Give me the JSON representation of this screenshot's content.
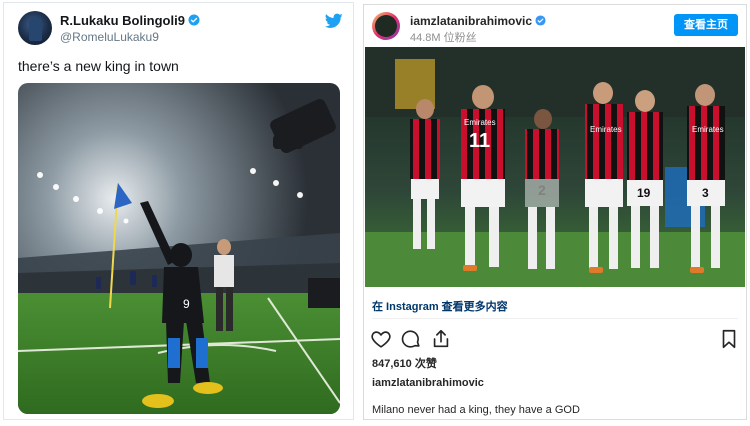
{
  "twitter": {
    "display_name": "R.Lukaku Bolingoli9",
    "handle": "@RomeluLukaku9",
    "tweet_text": "there’s a new king in town",
    "icons": {
      "verified": "verified-badge-icon",
      "logo": "twitter-bird-icon"
    },
    "colors": {
      "brand": "#1da1f2",
      "pitch": "#3f8a2a"
    },
    "photo": {
      "jersey_number": "9"
    }
  },
  "instagram": {
    "username": "iamzlatanibrahimovic",
    "followers": "44.8M 位粉丝",
    "view_profile_label": "查看主页",
    "link_text": "在 Instagram 查看更多内容",
    "likes": "847,610 次赞",
    "caption_user": "iamzlatanibrahimovic",
    "caption_text": "Milano never had a king, they have a GOD",
    "icons": {
      "like": "heart-icon",
      "comment": "comment-icon",
      "share": "share-icon",
      "save": "bookmark-icon",
      "verified": "verified-badge-icon"
    },
    "colors": {
      "button": "#0095f6",
      "jersey_red": "#c8102e",
      "jersey_black": "#111111"
    },
    "photo": {
      "jersey_numbers": [
        "11",
        "2",
        "19",
        "3"
      ],
      "sponsor": "Emirates"
    }
  }
}
